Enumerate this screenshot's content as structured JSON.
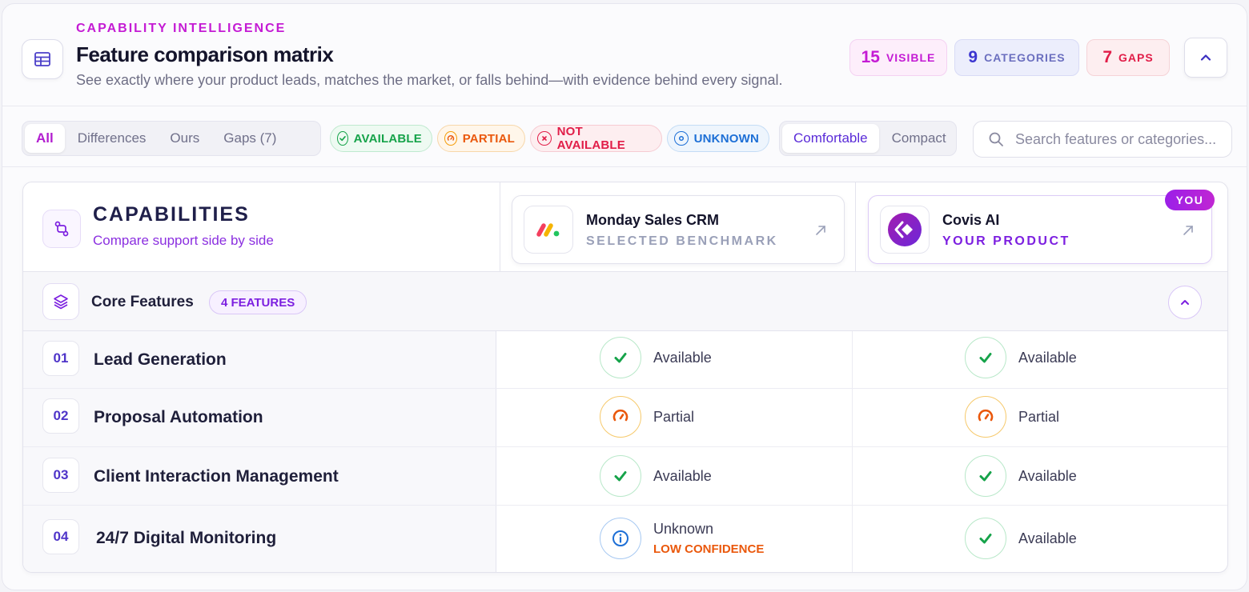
{
  "header": {
    "eyebrow": "CAPABILITY INTELLIGENCE",
    "title": "Feature comparison matrix",
    "subtitle": "See exactly where your product leads, matches the market, or falls behind—with evidence behind every signal.",
    "stats": {
      "visible": {
        "value": "15",
        "label": "VISIBLE"
      },
      "categories": {
        "value": "9",
        "label": "CATEGORIES"
      },
      "gaps": {
        "value": "7",
        "label": "GAPS"
      }
    }
  },
  "filters": {
    "tabs": [
      "All",
      "Differences",
      "Ours",
      "Gaps (7)"
    ],
    "active_tab": "All",
    "legend": {
      "available": "AVAILABLE",
      "partial": "PARTIAL",
      "not_available": "NOT AVAILABLE",
      "unknown": "UNKNOWN"
    },
    "density": [
      "Comfortable",
      "Compact"
    ],
    "active_density": "Comfortable",
    "search_placeholder": "Search features or categories..."
  },
  "matrix": {
    "capabilities_title": "CAPABILITIES",
    "capabilities_subtitle": "Compare support side by side",
    "products": [
      {
        "name": "Monday Sales CRM",
        "role": "SELECTED BENCHMARK"
      },
      {
        "name": "Covis AI",
        "role": "YOUR PRODUCT",
        "badge": "YOU"
      }
    ],
    "group": {
      "name": "Core Features",
      "count_label": "4 FEATURES"
    },
    "rows": [
      {
        "num": "01",
        "name": "Lead Generation",
        "benchmark": {
          "status": "available",
          "label": "Available"
        },
        "ours": {
          "status": "available",
          "label": "Available"
        }
      },
      {
        "num": "02",
        "name": "Proposal Automation",
        "benchmark": {
          "status": "partial",
          "label": "Partial"
        },
        "ours": {
          "status": "partial",
          "label": "Partial"
        }
      },
      {
        "num": "03",
        "name": "Client Interaction Management",
        "benchmark": {
          "status": "available",
          "label": "Available"
        },
        "ours": {
          "status": "available",
          "label": "Available"
        }
      },
      {
        "num": "04",
        "name": "24/7 Digital Monitoring",
        "benchmark": {
          "status": "unknown",
          "label": "Unknown",
          "note": "LOW CONFIDENCE"
        },
        "ours": {
          "status": "available",
          "label": "Available"
        }
      }
    ]
  },
  "colors": {
    "accent": "#c41bd4",
    "brand_purple": "#7c1fe0",
    "available": "#16a34a",
    "partial": "#ea580c",
    "not_available": "#e11d48",
    "unknown": "#1d6fd6"
  }
}
